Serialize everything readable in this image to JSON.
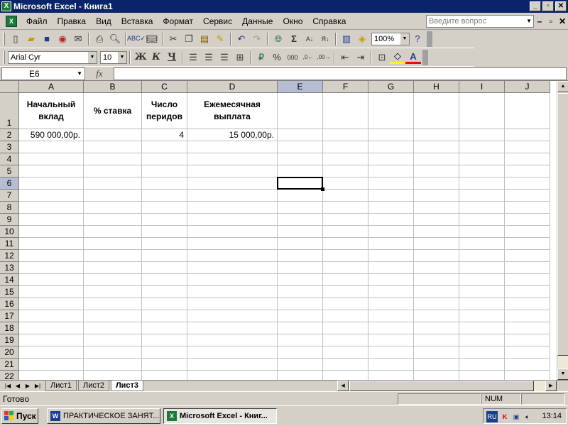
{
  "window": {
    "title": "Microsoft Excel - Книга1",
    "app_icon": "excel-icon",
    "controls": [
      "_",
      "▫",
      "✕"
    ]
  },
  "menu": {
    "items": [
      "Файл",
      "Правка",
      "Вид",
      "Вставка",
      "Формат",
      "Сервис",
      "Данные",
      "Окно",
      "Справка"
    ],
    "help_placeholder": "Введите вопрос",
    "doc_controls": [
      "–",
      "▫",
      "✕"
    ]
  },
  "toolbar_standard": {
    "icons": [
      "new-icon",
      "open-icon",
      "save-icon",
      "permission-icon",
      "email-icon",
      "print-icon",
      "print-preview-icon",
      "spelling-icon",
      "research-icon",
      "cut-icon",
      "copy-icon",
      "paste-icon",
      "format-painter-icon",
      "undo-icon",
      "redo-icon",
      "hyperlink-icon",
      "autosum-icon",
      "sort-asc-icon",
      "sort-desc-icon",
      "chart-wizard-icon",
      "drawing-icon",
      "help-icon"
    ],
    "zoom": "100%"
  },
  "toolbar_formatting": {
    "font": "Arial Cyr",
    "size": "10",
    "bold": "Ж",
    "italic": "К",
    "underline": "Ч",
    "icons": [
      "align-left-icon",
      "align-center-icon",
      "align-right-icon",
      "merge-center-icon",
      "currency-icon",
      "percent-icon",
      "thousands-icon",
      "increase-decimal-icon",
      "decrease-decimal-icon",
      "decrease-indent-icon",
      "increase-indent-icon",
      "borders-icon",
      "fill-color-icon",
      "font-color-icon"
    ],
    "fill_color": "#ffff00",
    "font_color": "#ff0000"
  },
  "formula_bar": {
    "name_box": "E6",
    "fx": "fx",
    "formula": ""
  },
  "grid": {
    "columns": [
      "A",
      "B",
      "C",
      "D",
      "E",
      "F",
      "G",
      "H",
      "I",
      "J"
    ],
    "selected_column": "E",
    "rows": [
      "1",
      "2",
      "3",
      "4",
      "5",
      "6",
      "7",
      "8",
      "9",
      "10",
      "11",
      "12",
      "13",
      "14",
      "15",
      "16",
      "17",
      "18",
      "19",
      "20",
      "21",
      "22"
    ],
    "selected_row": "6",
    "headers": {
      "A1": "Начальный вклад",
      "B1": "% ставка",
      "C1": "Число перидов",
      "D1": "Ежемесячная выплата"
    },
    "values": {
      "A2": "590 000,00р.",
      "C2": "4",
      "D2": "15 000,00р."
    },
    "active_cell": "E6"
  },
  "sheets": {
    "tabs": [
      "Лист1",
      "Лист2",
      "Лист3"
    ],
    "active": "Лист3"
  },
  "status": {
    "text": "Готово",
    "num": "NUM"
  },
  "taskbar": {
    "start": "Пуск",
    "tasks": [
      {
        "label": "ПРАКТИЧЕСКОЕ ЗАНЯТ...",
        "icon": "word-icon",
        "active": false
      },
      {
        "label": "Microsoft Excel - Книг...",
        "icon": "excel-icon",
        "active": true
      }
    ],
    "tray": {
      "lang": "RU",
      "icons": [
        "kaspersky-icon",
        "network-icon",
        "volume-icon"
      ],
      "clock": "13:14"
    }
  }
}
